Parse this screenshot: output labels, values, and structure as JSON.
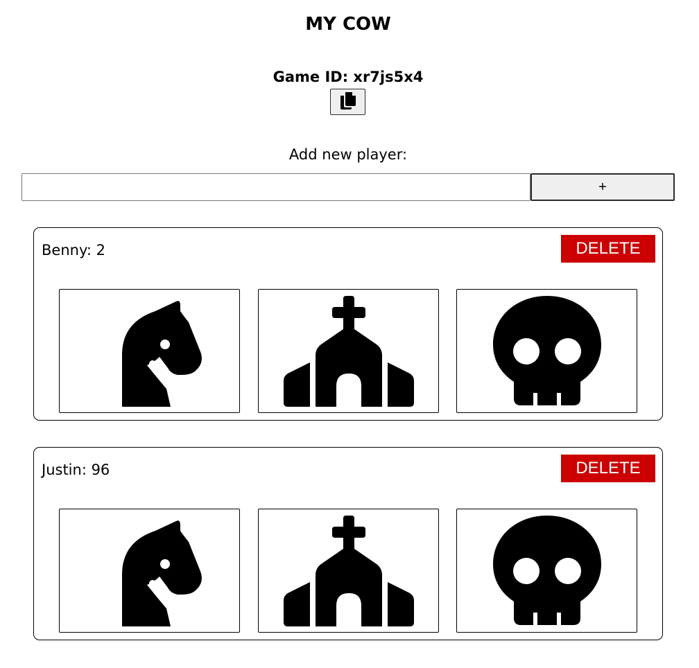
{
  "header": {
    "title": "MY COW",
    "game_id_text": "Game ID: xr7js5x4"
  },
  "copy_button": {
    "icon": "copy-icon"
  },
  "add_player": {
    "label": "Add new player:",
    "input_value": "",
    "input_placeholder": "",
    "add_button_label": "+"
  },
  "players": [
    {
      "score_text": "Benny: 2",
      "delete_label": "DELETE",
      "actions": [
        {
          "icon": "horse-icon"
        },
        {
          "icon": "church-icon"
        },
        {
          "icon": "skull-icon"
        }
      ]
    },
    {
      "score_text": "Justin: 96",
      "delete_label": "DELETE",
      "actions": [
        {
          "icon": "horse-icon"
        },
        {
          "icon": "church-icon"
        },
        {
          "icon": "skull-icon"
        }
      ]
    }
  ],
  "colors": {
    "delete_button": "#cc0000",
    "delete_text": "#ffffff",
    "text": "#000000",
    "button_bg": "#efefef"
  }
}
